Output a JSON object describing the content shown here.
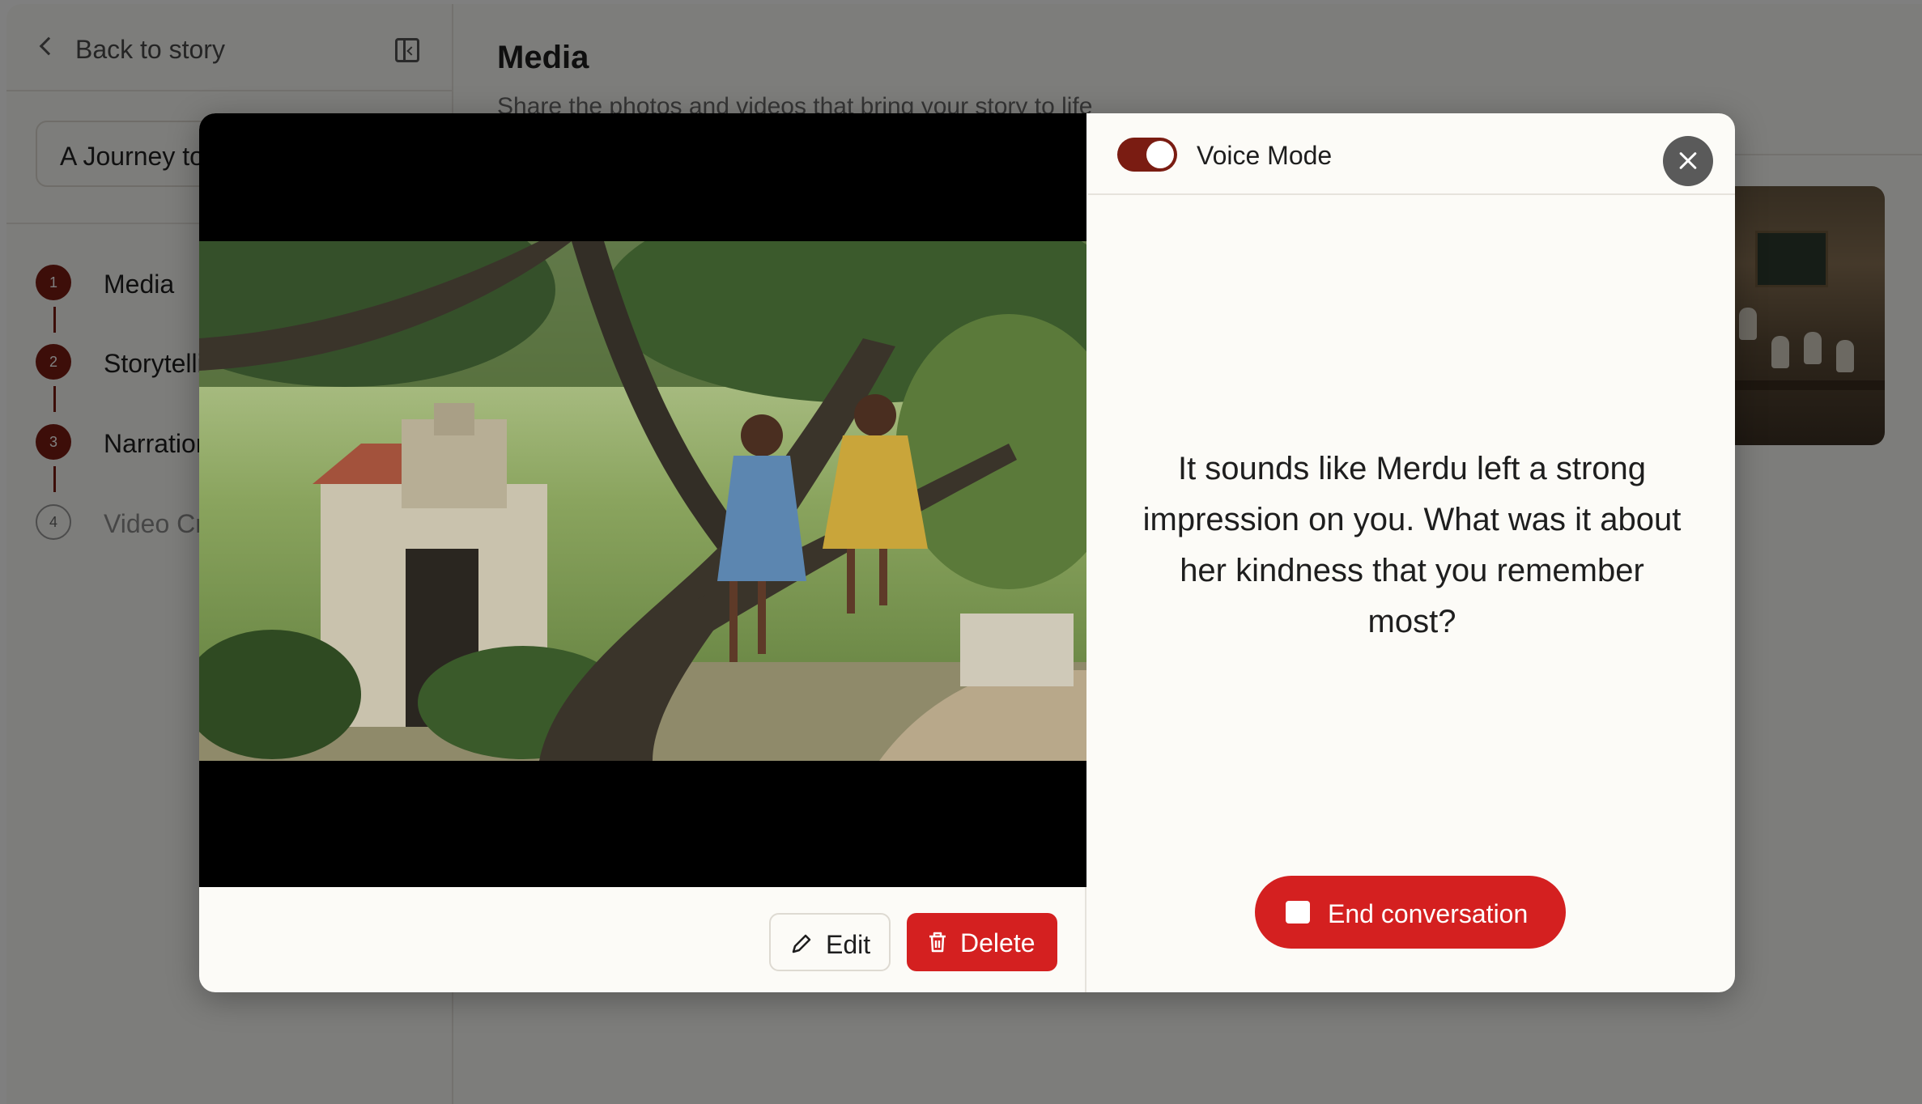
{
  "sidebar": {
    "back_label": "Back to story",
    "story_title": "A Journey to the Tamarind Tree",
    "steps": [
      {
        "number": "1",
        "label": "Media"
      },
      {
        "number": "2",
        "label": "Storytelling"
      },
      {
        "number": "3",
        "label": "Narration"
      },
      {
        "number": "4",
        "label": "Video Creation"
      }
    ]
  },
  "main": {
    "title": "Media",
    "subtitle": "Share the photos and videos that bring your story to life"
  },
  "modal": {
    "edit_label": "Edit",
    "delete_label": "Delete",
    "voice_mode_label": "Voice Mode",
    "voice_mode_on": true,
    "prompt": "It sounds like Merdu left a strong impression on you. What was it about her kindness that you remember most?",
    "end_label": "End conversation"
  },
  "colors": {
    "accent": "#7a1c12",
    "danger": "#d42020",
    "surface": "#fcfbf7"
  },
  "icons": [
    "chevron-left-icon",
    "sidebar-collapse-icon",
    "pencil-icon",
    "trash-icon",
    "close-icon",
    "stop-icon"
  ]
}
